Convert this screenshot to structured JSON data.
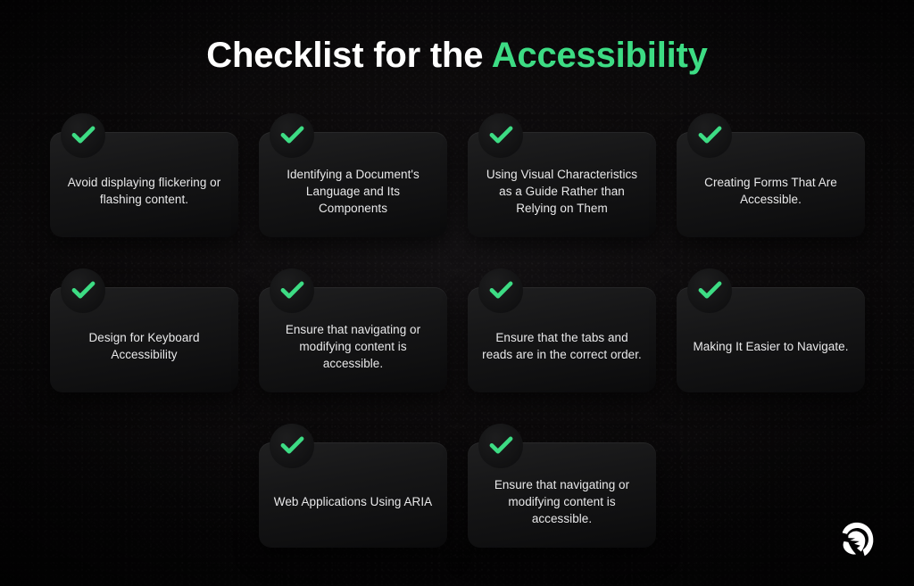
{
  "title": {
    "lead": "Checklist for the ",
    "accent": "Accessibility"
  },
  "colors": {
    "accent_green": "#3ddc84",
    "background": "#0a0809",
    "card_surface": "#161617",
    "text": "#e9e9ea"
  },
  "icons": {
    "check": "check-icon",
    "logo": "spartan-helmet-logo"
  },
  "cards": [
    {
      "text": "Avoid displaying flickering or flashing content."
    },
    {
      "text": "Identifying a Document's Language and Its Components"
    },
    {
      "text": "Using Visual Characteristics as a Guide Rather than Relying on Them"
    },
    {
      "text": "Creating Forms That Are Accessible."
    },
    {
      "text": "Design for Keyboard Accessibility"
    },
    {
      "text": "Ensure that navigating or modifying content is accessible."
    },
    {
      "text": "Ensure that the tabs and reads are in the correct order."
    },
    {
      "text": "Making It Easier to Navigate."
    },
    {
      "text": "Web Applications Using ARIA"
    },
    {
      "text": "Ensure that navigating or modifying content is accessible."
    }
  ]
}
